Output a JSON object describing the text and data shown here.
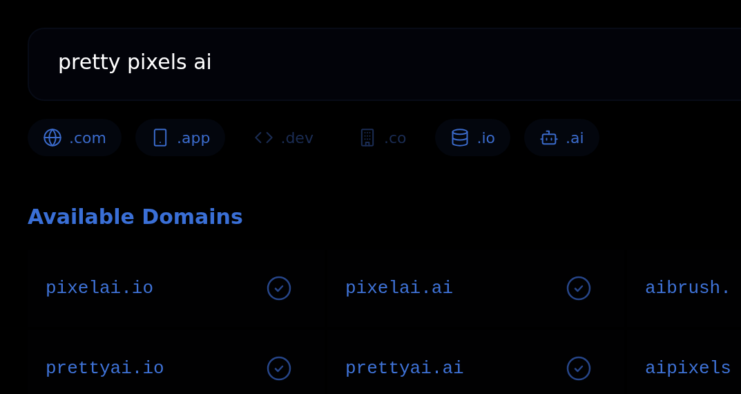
{
  "search": {
    "value": "pretty pixels ai"
  },
  "extensions": [
    {
      "label": ".com",
      "kind": "globe",
      "selected": true
    },
    {
      "label": ".app",
      "kind": "phone",
      "selected": true
    },
    {
      "label": ".dev",
      "kind": "code",
      "selected": false
    },
    {
      "label": ".co",
      "kind": "building",
      "selected": false
    },
    {
      "label": ".io",
      "kind": "database",
      "selected": true
    },
    {
      "label": ".ai",
      "kind": "robot",
      "selected": true
    }
  ],
  "heading": "Available Domains",
  "domains": [
    {
      "name": "pixelai.io",
      "available": true
    },
    {
      "name": "pixelai.ai",
      "available": true
    },
    {
      "name": "aibrush."
    },
    {
      "name": "prettyai.io",
      "available": true
    },
    {
      "name": "prettyai.ai",
      "available": true
    },
    {
      "name": "aipixels"
    }
  ]
}
